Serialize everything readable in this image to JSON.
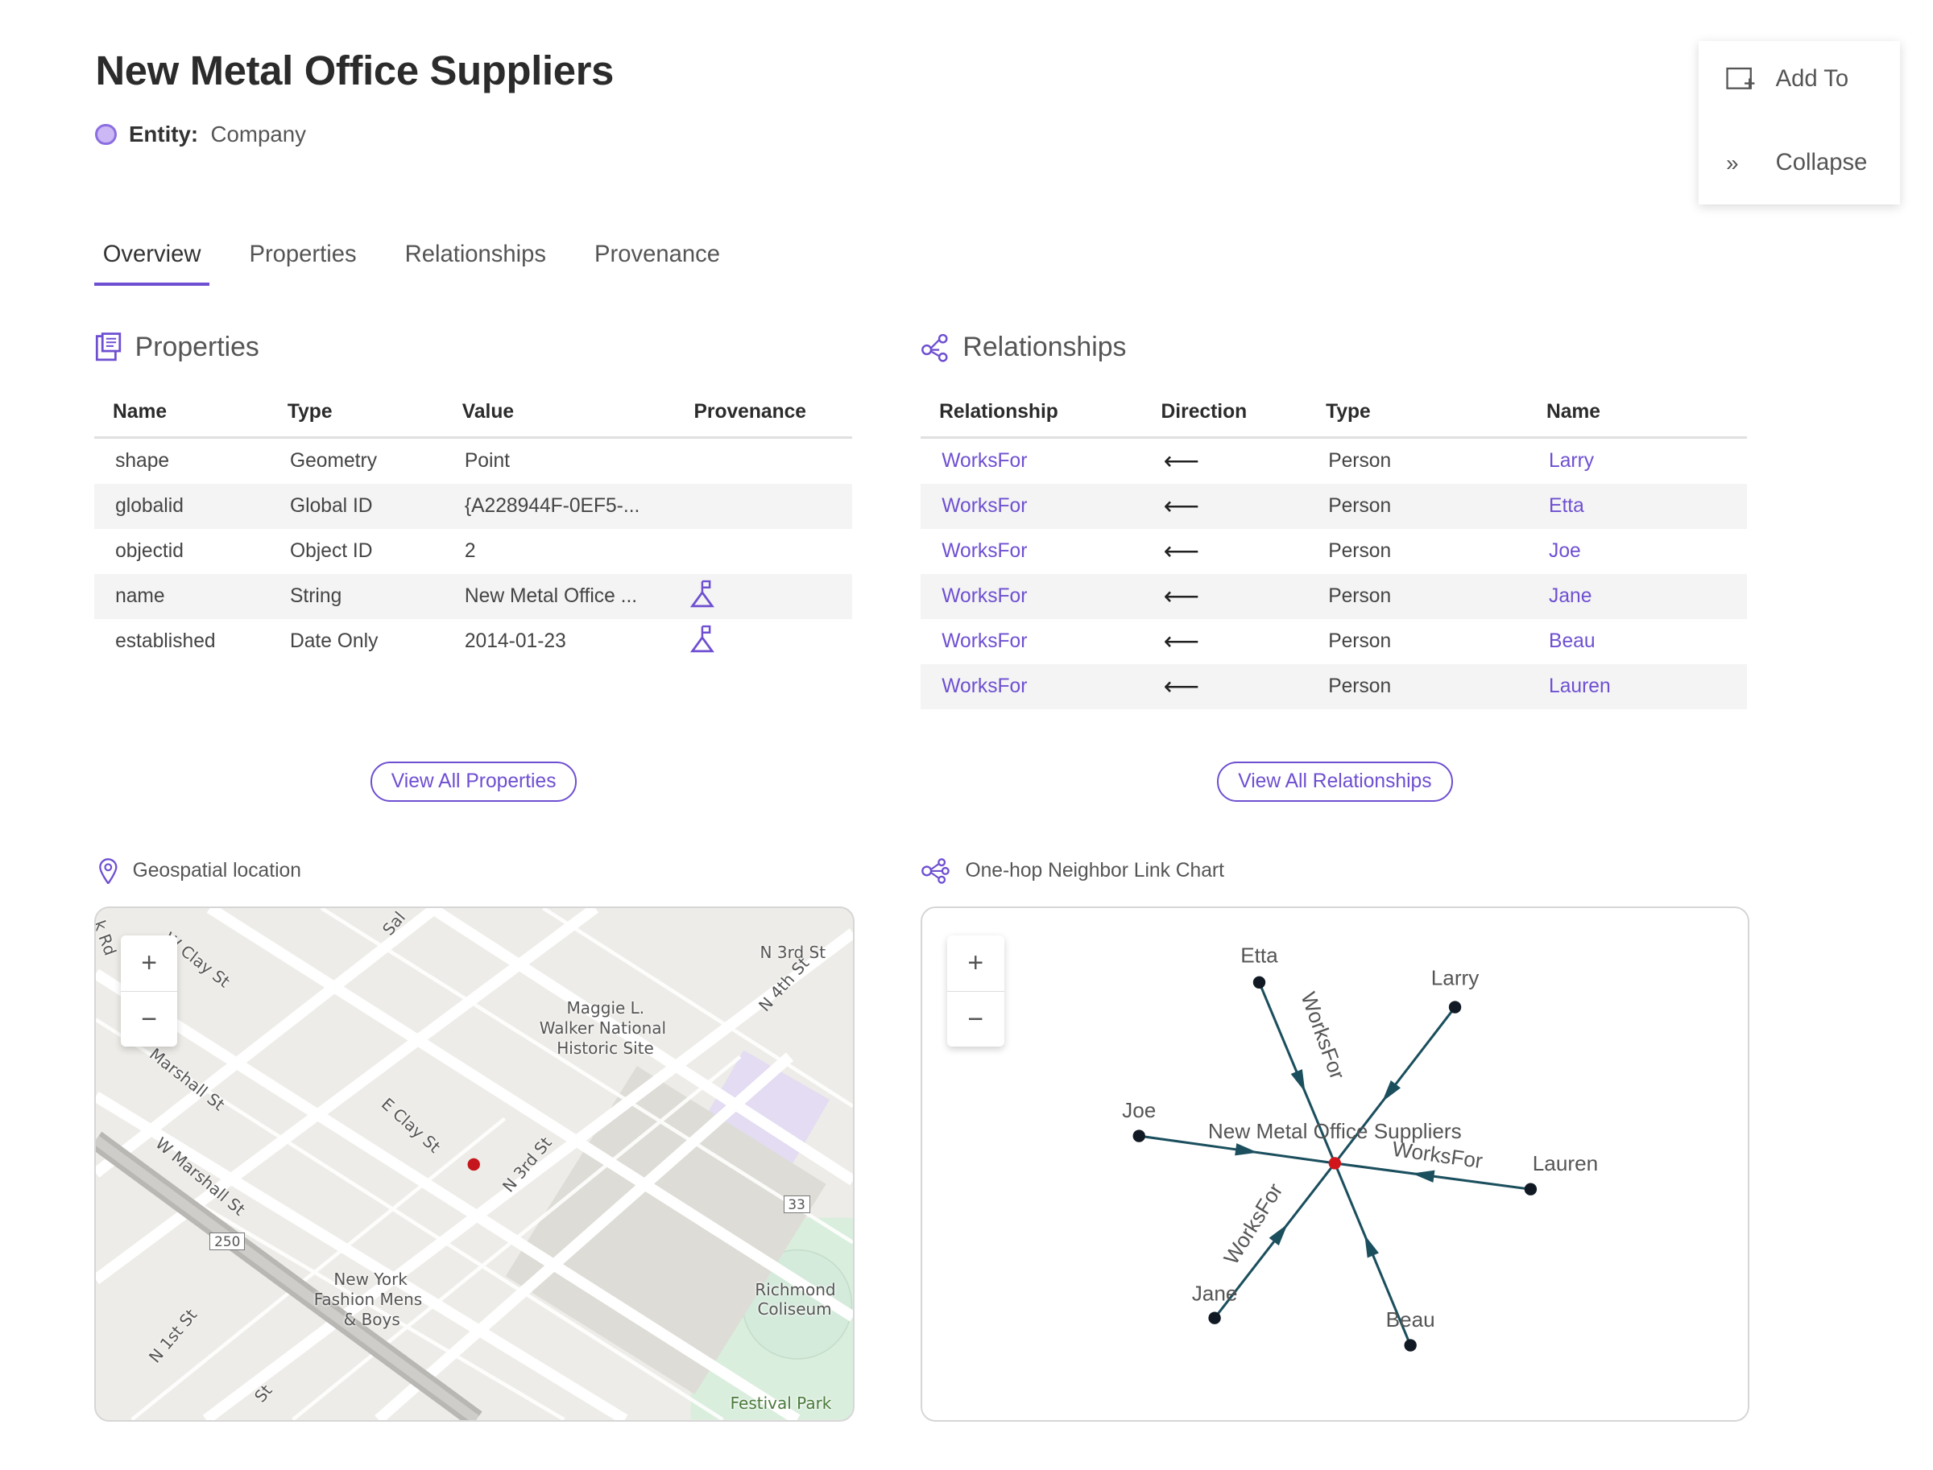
{
  "header": {
    "title": "New Metal Office Suppliers",
    "entity_label": "Entity:",
    "entity_type": "Company",
    "entity_color": "#cbb8f5"
  },
  "actions": {
    "add_to": "Add To",
    "collapse": "Collapse"
  },
  "tabs": [
    {
      "label": "Overview",
      "active": true
    },
    {
      "label": "Properties"
    },
    {
      "label": "Relationships"
    },
    {
      "label": "Provenance"
    }
  ],
  "properties": {
    "title": "Properties",
    "columns": [
      "Name",
      "Type",
      "Value",
      "Provenance"
    ],
    "rows": [
      {
        "name": "shape",
        "type": "Geometry",
        "value": "Point",
        "provenance": false
      },
      {
        "name": "globalid",
        "type": "Global ID",
        "value": "{A228944F-0EF5-...",
        "provenance": false
      },
      {
        "name": "objectid",
        "type": "Object ID",
        "value": "2",
        "provenance": false
      },
      {
        "name": "name",
        "type": "String",
        "value": "New Metal Office ...",
        "provenance": true
      },
      {
        "name": "established",
        "type": "Date Only",
        "value": "2014-01-23",
        "provenance": true
      }
    ],
    "view_all": "View All Properties"
  },
  "relationships": {
    "title": "Relationships",
    "columns": [
      "Relationship",
      "Direction",
      "Type",
      "Name"
    ],
    "rows": [
      {
        "relationship": "WorksFor",
        "direction": "⟵",
        "type": "Person",
        "name": "Larry"
      },
      {
        "relationship": "WorksFor",
        "direction": "⟵",
        "type": "Person",
        "name": "Etta"
      },
      {
        "relationship": "WorksFor",
        "direction": "⟵",
        "type": "Person",
        "name": "Joe"
      },
      {
        "relationship": "WorksFor",
        "direction": "⟵",
        "type": "Person",
        "name": "Jane"
      },
      {
        "relationship": "WorksFor",
        "direction": "⟵",
        "type": "Person",
        "name": "Beau"
      },
      {
        "relationship": "WorksFor",
        "direction": "⟵",
        "type": "Person",
        "name": "Lauren"
      }
    ],
    "view_all": "View All Relationships"
  },
  "map": {
    "title": "Geospatial location",
    "zoom_in": "+",
    "zoom_out": "−",
    "labels": [
      "W Clay St",
      "N 3rd St",
      "Maggie L.",
      "Walker National",
      "Historic Site",
      "N 4th St",
      "E Clay St",
      "W Marshall St",
      "Marshall St",
      "N 3rd St",
      "33",
      "250",
      "New York",
      "Fashion Mens",
      "& Boys",
      "Richmond",
      "Coliseum",
      "Festival Park",
      "N 1st St",
      "Sal",
      "k Rd",
      "St"
    ]
  },
  "link_chart": {
    "title": "One-hop Neighbor Link Chart",
    "zoom_in": "+",
    "zoom_out": "−",
    "center": "New Metal Office Suppliers",
    "edge_label": "WorksFor",
    "nodes": [
      "Etta",
      "Larry",
      "Joe",
      "Lauren",
      "Jane",
      "Beau"
    ],
    "edge_color": "#1b4f5e",
    "center_color": "#d0161b",
    "node_color": "#111a24"
  },
  "accent": "#6e4fd1"
}
